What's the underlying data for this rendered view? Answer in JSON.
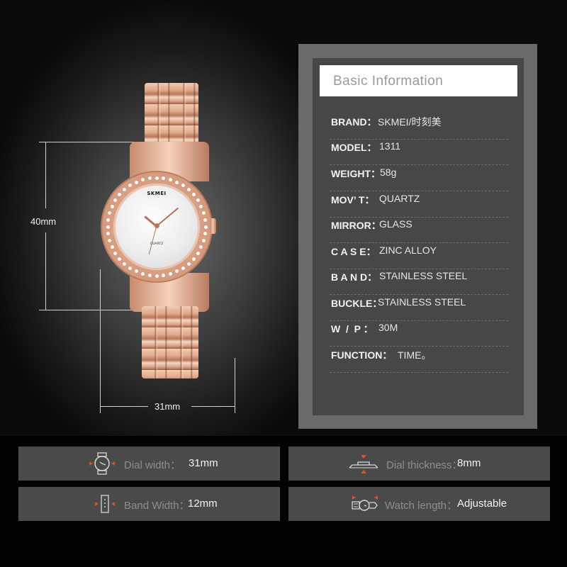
{
  "dimensions": {
    "height_label": "40mm",
    "width_label": "31mm"
  },
  "watch": {
    "brand_mark": "SKMEI",
    "dial_text": "QUARTZ",
    "case_color": "#d99e80",
    "dial_color": "#f2f2f2"
  },
  "panel": {
    "title": "Basic Information",
    "specs": [
      {
        "key": "BRAND：",
        "value": "SKMEI/时刻美"
      },
      {
        "key": "MODEL：",
        "value": "1311"
      },
      {
        "key": "WEIGHT：",
        "value": "58g"
      },
      {
        "key": "MOV’ T：",
        "value": "QUARTZ"
      },
      {
        "key": "MIRROR：",
        "value": "GLASS"
      },
      {
        "key": "C A S E：",
        "value": "ZINC ALLOY"
      },
      {
        "key": "B A N D：",
        "value": "STAINLESS STEEL"
      },
      {
        "key": "BUCKLE：",
        "value": "STAINLESS STEEL"
      },
      {
        "key": "W  /  P ：",
        "value": "30M"
      },
      {
        "key": "FUNCTION：",
        "value": "TIME。"
      }
    ]
  },
  "cards": [
    {
      "icon": "dial-width-icon",
      "label": "Dial width：",
      "value": "31mm"
    },
    {
      "icon": "dial-thickness-icon",
      "label": "Dial thickness：",
      "value": "8mm"
    },
    {
      "icon": "band-width-icon",
      "label": "Band Width：",
      "value": "12mm"
    },
    {
      "icon": "watch-length-icon",
      "label": "Watch length：",
      "value": "Adjustable"
    }
  ],
  "colors": {
    "accent_arrow": "#e0531f",
    "panel_outer": "#6a6a6a",
    "panel_inner": "#474747",
    "card_bg": "#4a4a4a"
  }
}
